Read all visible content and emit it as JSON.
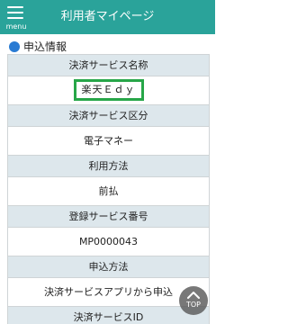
{
  "header": {
    "menu_label": "menu",
    "title": "利用者マイページ",
    "color": "#2aa39a"
  },
  "section": {
    "title": "申込情報",
    "dot_color": "#2a7bd3"
  },
  "rows": {
    "payment_service_name_label": "決済サービス名称",
    "payment_service_name_value": "楽天Ｅｄｙ",
    "payment_service_type_label": "決済サービス区分",
    "payment_service_type_value": "電子マネー",
    "usage_method_label": "利用方法",
    "usage_method_value": "前払",
    "registered_service_number_label": "登録サービス番号",
    "registered_service_number_value": "MP0000043",
    "application_method_label": "申込方法",
    "application_method_value": "決済サービスアプリから申込",
    "payment_service_id_label": "決済サービスID"
  },
  "top_button": {
    "label": "TOP",
    "icon": "chevron-up-icon"
  },
  "highlight_color": "#27a648"
}
